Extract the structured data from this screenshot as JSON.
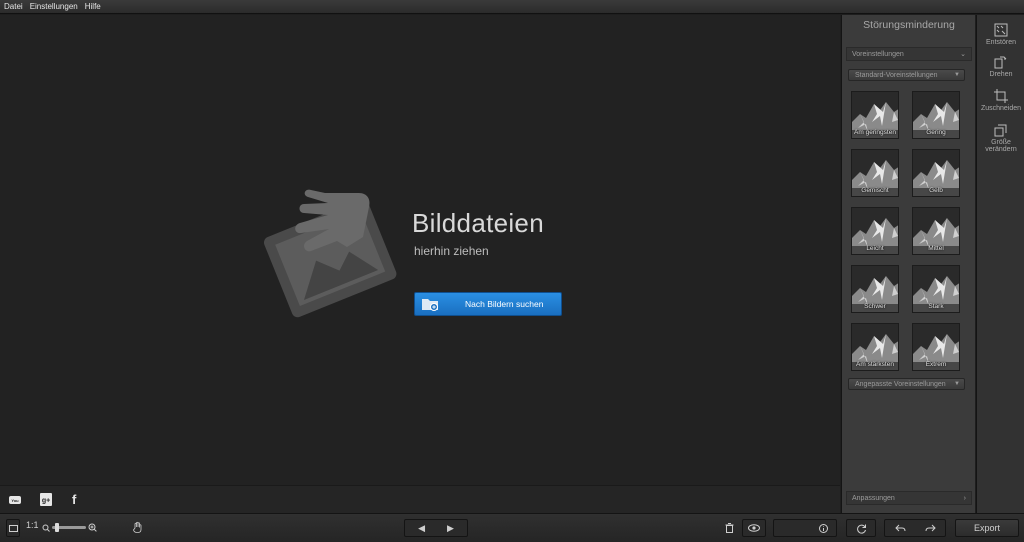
{
  "menu": [
    "Datei",
    "Einstellungen",
    "Hilfe"
  ],
  "dropzone": {
    "title": "Bilddateien",
    "subtitle": "hierhin ziehen",
    "browse_label": "Nach Bildern suchen"
  },
  "social": [
    "youtube-icon",
    "google-plus-icon",
    "facebook-icon"
  ],
  "social_glyphs": {
    "youtube": "You",
    "gplus": "g+",
    "facebook": "f"
  },
  "bottom": {
    "zoom_label": "1:1",
    "zoom_level": 0.1,
    "export_label": "Export"
  },
  "panel": {
    "title": "Störungsminderung",
    "presets_header": "Voreinstellungen",
    "preset_dropdown": "Standard-Voreinstellungen",
    "custom_dropdown": "Angepasste Voreinstellungen",
    "adjust_header": "Anpassungen",
    "presets": [
      "Am geringsten",
      "Gering",
      "Gemischt",
      "Gelb",
      "Leicht",
      "Mittel",
      "Schwer",
      "Stark",
      "Am stärksten",
      "Extrem"
    ]
  },
  "tools": [
    {
      "label": "Entstören",
      "icon": "denoise-icon"
    },
    {
      "label": "Drehen",
      "icon": "rotate-icon"
    },
    {
      "label": "Zuschneiden",
      "icon": "crop-icon"
    },
    {
      "label": "Größe verändern",
      "icon": "resize-icon"
    }
  ],
  "colors": {
    "accent": "#1a7ad4",
    "canvas": "#222222",
    "panel": "#3b3b3b"
  }
}
